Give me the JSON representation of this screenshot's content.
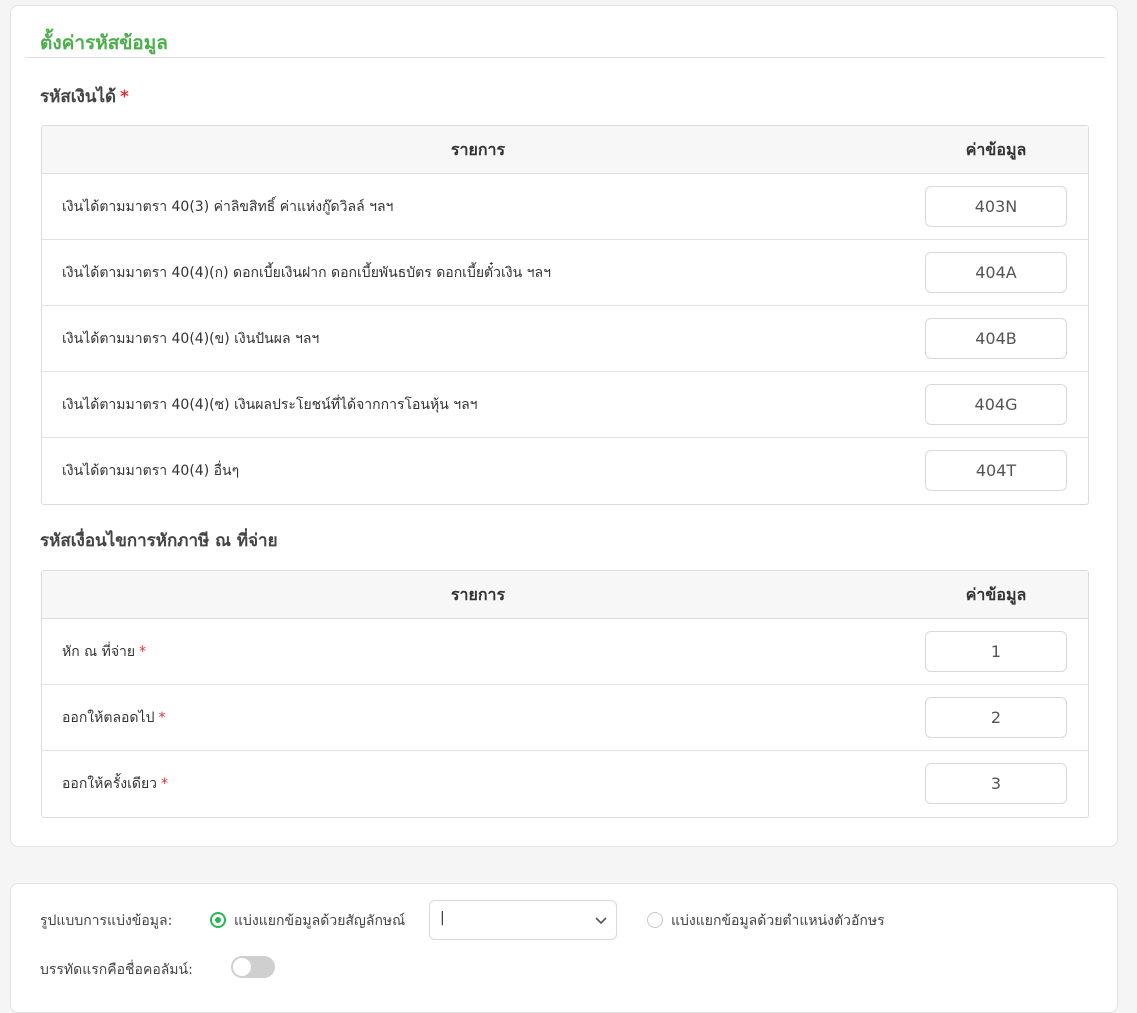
{
  "settings": {
    "title": "ตั้งค่ารหัสข้อมูล",
    "income_code": {
      "label": "รหัสเงินได้",
      "required_mark": "*",
      "header_item": "รายการ",
      "header_value": "ค่าข้อมูล",
      "rows": [
        {
          "label": "เงินได้ตามมาตรา 40(3) ค่าลิขสิทธิ์ ค่าแห่งกู๊ดวิลล์ ฯลฯ",
          "value": "403N"
        },
        {
          "label": "เงินได้ตามมาตรา 40(4)(ก) ดอกเบี้ยเงินฝาก ดอกเบี้ยพันธบัตร ดอกเบี้ยตั๋วเงิน ฯลฯ",
          "value": "404A"
        },
        {
          "label": "เงินได้ตามมาตรา 40(4)(ข) เงินปันผล ฯลฯ",
          "value": "404B"
        },
        {
          "label": "เงินได้ตามมาตรา 40(4)(ซ) เงินผลประโยชน์ที่ได้จากการโอนหุ้น ฯลฯ",
          "value": "404G"
        },
        {
          "label": "เงินได้ตามมาตรา 40(4) อื่นๆ",
          "value": "404T"
        }
      ]
    },
    "withholding_code": {
      "label": "รหัสเงื่อนไขการหักภาษี ณ ที่จ่าย",
      "header_item": "รายการ",
      "header_value": "ค่าข้อมูล",
      "rows": [
        {
          "label": "หัก ณ ที่จ่าย",
          "required_mark": "*",
          "value": "1"
        },
        {
          "label": "ออกให้ตลอดไป",
          "required_mark": "*",
          "value": "2"
        },
        {
          "label": "ออกให้ครั้งเดียว",
          "required_mark": "*",
          "value": "3"
        }
      ]
    }
  },
  "split": {
    "format_label": "รูปแบบการแบ่งข้อมูล:",
    "option_symbol": "แบ่งแยกข้อมูลด้วยสัญลักษณ์",
    "option_symbol_selected": true,
    "delimiter_value": "|",
    "option_position": "แบ่งแยกข้อมูลด้วยตำแหน่งตัวอักษร",
    "header_row_label": "บรรทัดแรกคือชื่อคอลัมน์:",
    "header_row_enabled": false
  },
  "colors": {
    "title_green": "#4cae4c",
    "radio_green": "#2fb358",
    "required_red": "#d9343b"
  }
}
